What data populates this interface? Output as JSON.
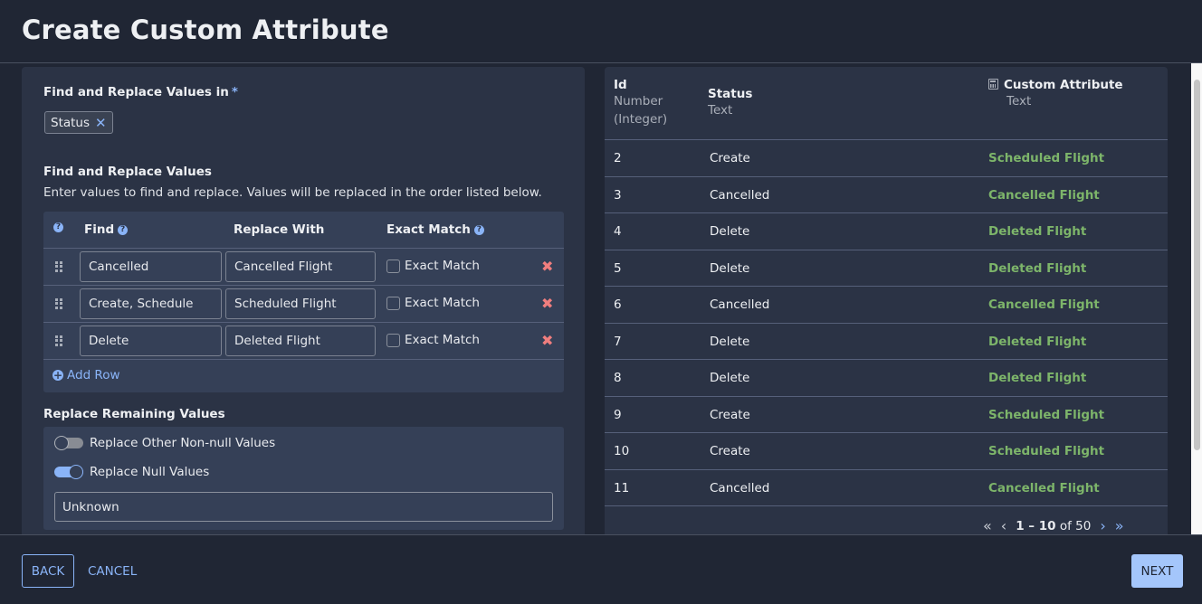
{
  "header": {
    "title": "Create Custom Attribute"
  },
  "left": {
    "find_in": {
      "label": "Find and Replace Values in",
      "required_mark": "*",
      "chips": [
        {
          "label": "Status",
          "remove_icon": "close-icon"
        }
      ]
    },
    "find_replace": {
      "label": "Find and Replace Values",
      "description": "Enter values to find and replace. Values will be replaced in the order listed below.",
      "columns": {
        "find": "Find",
        "replace": "Replace With",
        "exact": "Exact Match"
      },
      "rows": [
        {
          "find": "Cancelled",
          "replace": "Cancelled Flight",
          "exact_label": "Exact Match",
          "exact_checked": false
        },
        {
          "find": "Create, Schedule",
          "replace": "Scheduled Flight",
          "exact_label": "Exact Match",
          "exact_checked": false
        },
        {
          "find": "Delete",
          "replace": "Deleted Flight",
          "exact_label": "Exact Match",
          "exact_checked": false
        }
      ],
      "add_row_label": "Add Row"
    },
    "remaining": {
      "label": "Replace Remaining Values",
      "non_null_toggle": {
        "label": "Replace Other Non-null Values",
        "on": false
      },
      "null_toggle": {
        "label": "Replace Null Values",
        "on": true
      },
      "null_value": "Unknown"
    }
  },
  "preview": {
    "columns": [
      {
        "name": "Id",
        "type": "Number (Integer)"
      },
      {
        "name": "Status",
        "type": "Text"
      },
      {
        "name": "Custom Attribute",
        "type": "Text",
        "icon": "calculator-icon"
      }
    ],
    "rows": [
      {
        "id": "2",
        "status": "Create",
        "custom": "Scheduled Flight"
      },
      {
        "id": "3",
        "status": "Cancelled",
        "custom": "Cancelled Flight"
      },
      {
        "id": "4",
        "status": "Delete",
        "custom": "Deleted Flight"
      },
      {
        "id": "5",
        "status": "Delete",
        "custom": "Deleted Flight"
      },
      {
        "id": "6",
        "status": "Cancelled",
        "custom": "Cancelled Flight"
      },
      {
        "id": "7",
        "status": "Delete",
        "custom": "Deleted Flight"
      },
      {
        "id": "8",
        "status": "Delete",
        "custom": "Deleted Flight"
      },
      {
        "id": "9",
        "status": "Create",
        "custom": "Scheduled Flight"
      },
      {
        "id": "10",
        "status": "Create",
        "custom": "Scheduled Flight"
      },
      {
        "id": "11",
        "status": "Cancelled",
        "custom": "Cancelled Flight"
      }
    ],
    "pagination": {
      "range": "1 – 10",
      "of_label": "of",
      "total": "50"
    }
  },
  "footer": {
    "back": "BACK",
    "cancel": "CANCEL",
    "next": "NEXT"
  },
  "colors": {
    "accent": "#8ab4f8",
    "success_text": "#7db56a",
    "danger": "#f07e7e",
    "background": "#202634",
    "card": "#2b3345"
  }
}
